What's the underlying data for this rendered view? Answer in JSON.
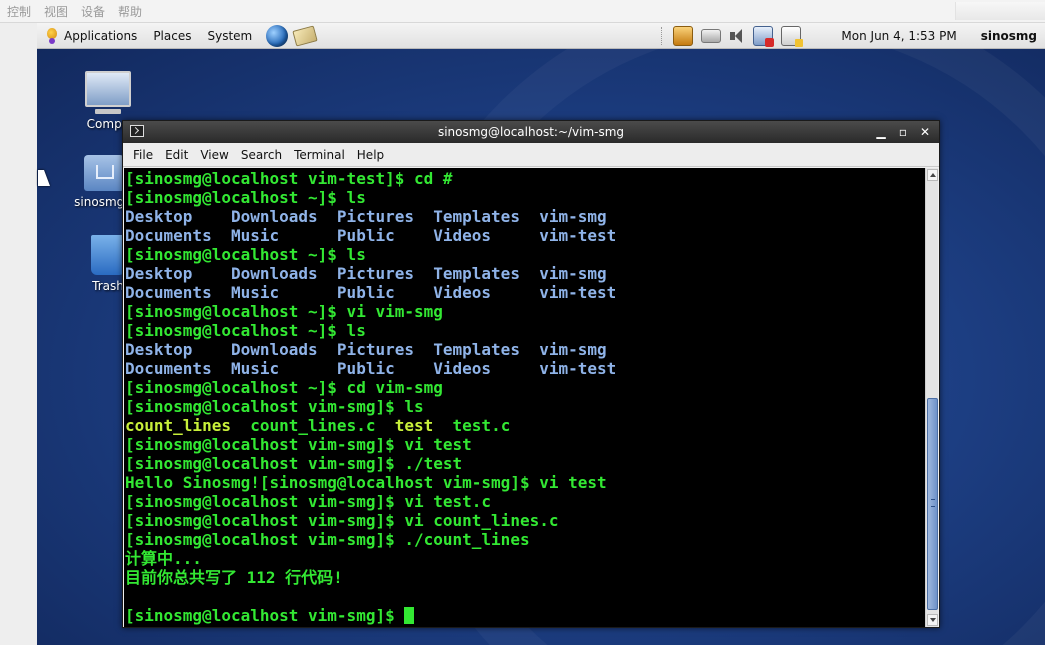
{
  "vm_menubar": {
    "items": [
      "控制",
      "视图",
      "设备",
      "帮助"
    ]
  },
  "panel": {
    "menus": [
      "Applications",
      "Places",
      "System"
    ],
    "launchers": [
      "globe-icon",
      "mail-icon"
    ],
    "tray": [
      "update-icon",
      "printer-icon",
      "volume-icon",
      "network-icon",
      "battery-icon"
    ],
    "clock": "Mon Jun  4,  1:53 PM",
    "user": "sinosmg"
  },
  "desktop": {
    "icons": [
      {
        "label": "Compu",
        "icon": "computer-icon"
      },
      {
        "label": "sinosmg's",
        "icon": "home-folder-icon"
      },
      {
        "label": "Trash",
        "icon": "trash-icon"
      }
    ]
  },
  "terminal": {
    "title": "sinosmg@localhost:~/vim-smg",
    "menus": [
      "File",
      "Edit",
      "View",
      "Search",
      "Terminal",
      "Help"
    ],
    "lines": [
      [
        {
          "t": "[sinosmg@localhost vim-test]$ cd #",
          "c": "green"
        }
      ],
      [
        {
          "t": "[sinosmg@localhost ~]$ ls",
          "c": "green"
        }
      ],
      [
        {
          "t": "Desktop    Downloads  Pictures  Templates  vim-smg",
          "c": "blue"
        }
      ],
      [
        {
          "t": "Documents  Music      Public    Videos     vim-test",
          "c": "blue"
        }
      ],
      [
        {
          "t": "[sinosmg@localhost ~]$ ls",
          "c": "green"
        }
      ],
      [
        {
          "t": "Desktop    Downloads  Pictures  Templates  vim-smg",
          "c": "blue"
        }
      ],
      [
        {
          "t": "Documents  Music      Public    Videos     vim-test",
          "c": "blue"
        }
      ],
      [
        {
          "t": "[sinosmg@localhost ~]$ vi vim-smg",
          "c": "green"
        }
      ],
      [
        {
          "t": "[sinosmg@localhost ~]$ ls",
          "c": "green"
        }
      ],
      [
        {
          "t": "Desktop    Downloads  Pictures  Templates  vim-smg",
          "c": "blue"
        }
      ],
      [
        {
          "t": "Documents  Music      Public    Videos     vim-test",
          "c": "blue"
        }
      ],
      [
        {
          "t": "[sinosmg@localhost ~]$ cd vim-smg",
          "c": "green"
        }
      ],
      [
        {
          "t": "[sinosmg@localhost vim-smg]$ ls",
          "c": "green"
        }
      ],
      [
        {
          "t": "count_lines",
          "c": "yellow"
        },
        {
          "t": "  count_lines.c  ",
          "c": "green"
        },
        {
          "t": "test",
          "c": "yellow"
        },
        {
          "t": "  test.c",
          "c": "green"
        }
      ],
      [
        {
          "t": "[sinosmg@localhost vim-smg]$ vi test",
          "c": "green"
        }
      ],
      [
        {
          "t": "[sinosmg@localhost vim-smg]$ ./test",
          "c": "green"
        }
      ],
      [
        {
          "t": "Hello Sinosmg![sinosmg@localhost vim-smg]$ vi test",
          "c": "green"
        }
      ],
      [
        {
          "t": "[sinosmg@localhost vim-smg]$ vi test.c",
          "c": "green"
        }
      ],
      [
        {
          "t": "[sinosmg@localhost vim-smg]$ vi count_lines.c",
          "c": "green"
        }
      ],
      [
        {
          "t": "[sinosmg@localhost vim-smg]$ ./count_lines",
          "c": "green"
        }
      ],
      [
        {
          "t": "计算中...",
          "c": "green"
        }
      ],
      [
        {
          "t": "目前你总共写了 112 行代码!",
          "c": "green"
        }
      ],
      [
        {
          "t": "",
          "c": "green"
        }
      ],
      [
        {
          "t": "[sinosmg@localhost vim-smg]$ ",
          "c": "green"
        }
      ]
    ]
  },
  "colors": {
    "green": "#33e833",
    "blue": "#8fb3e8",
    "yellow": "#c8f03a"
  }
}
